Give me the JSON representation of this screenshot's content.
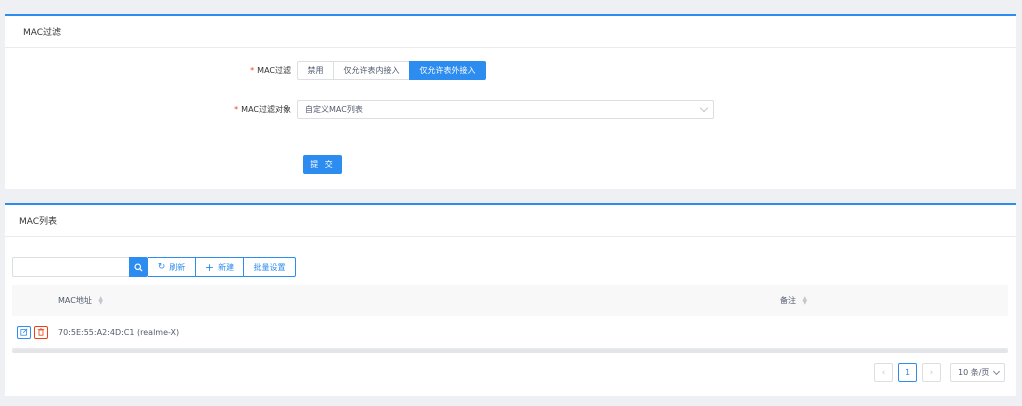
{
  "filter_card": {
    "title": "MAC过滤",
    "mode_label": "MAC过滤",
    "mode_options": [
      "禁用",
      "仅允许表内接入",
      "仅允许表外接入"
    ],
    "mode_selected": "仅允许表外接入",
    "target_label": "MAC过滤对象",
    "target_value": "自定义MAC列表",
    "submit_label": "提 交",
    "required_mark": "*"
  },
  "list_card": {
    "title": "MAC列表",
    "search": {
      "value": "",
      "placeholder": ""
    },
    "toolbar": {
      "refresh_label": "刷新",
      "new_label": "新建",
      "batch_label": "批量设置"
    },
    "table": {
      "columns": [
        "MAC地址",
        "备注"
      ],
      "rows": [
        {
          "mac": "70:5E:55:A2:4D:C1 (realme-X)",
          "note": ""
        }
      ]
    },
    "pagination": {
      "current_page": "1",
      "page_size": "10 条/页"
    }
  },
  "colors": {
    "primary": "#2d8cf0",
    "danger": "#ed4014",
    "background": "#eef0f4"
  },
  "icons": [
    "search-icon",
    "refresh-icon",
    "plus-icon",
    "edit-icon",
    "trash-icon",
    "chevron-down-icon",
    "chevron-left-icon",
    "chevron-right-icon",
    "sort-icon"
  ]
}
